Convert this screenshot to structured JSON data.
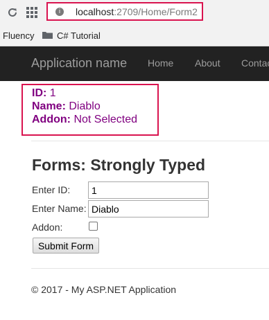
{
  "browser": {
    "url_host": "localhost",
    "url_rest": ":2709/Home/Form2",
    "bookmarks": [
      "Fluency",
      "C# Tutorial"
    ]
  },
  "navbar": {
    "brand": "Application name",
    "links": [
      "Home",
      "About",
      "Contact"
    ]
  },
  "result": {
    "id_label": "ID:",
    "id_value": "1",
    "name_label": "Name:",
    "name_value": "Diablo",
    "addon_label": "Addon:",
    "addon_value": "Not Selected"
  },
  "form": {
    "title": "Forms: Strongly Typed",
    "id_label": "Enter ID:",
    "id_value": "1",
    "name_label": "Enter Name:",
    "name_value": "Diablo",
    "addon_label": "Addon:",
    "addon_checked": false,
    "submit_label": "Submit Form"
  },
  "footer": {
    "text": "© 2017 - My ASP.NET Application"
  },
  "colors": {
    "highlight": "#d9134f",
    "result_text": "#800080",
    "navbar_bg": "#222222"
  }
}
